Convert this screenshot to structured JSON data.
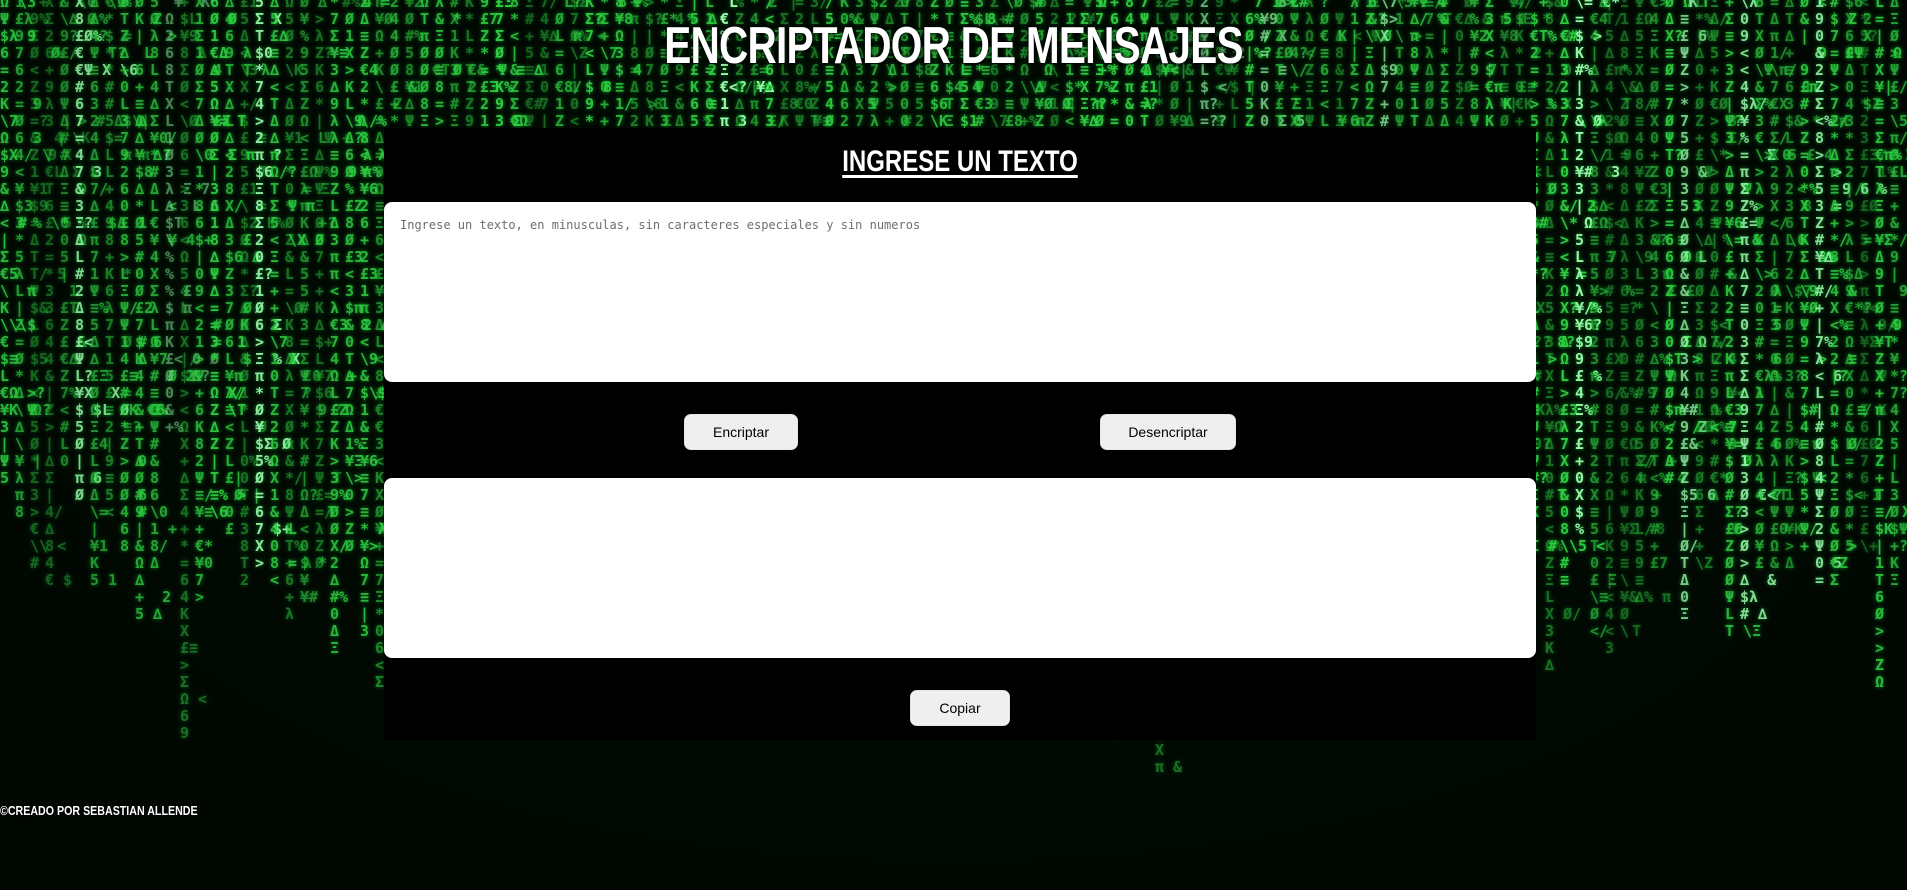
{
  "page": {
    "title": "ENCRIPTADOR DE MENSAJES",
    "background_theme": "matrix-green-code-rain",
    "accent_color": "#2ecc40"
  },
  "panel": {
    "heading": "INGRESE UN TEXTO",
    "input": {
      "placeholder": "Ingrese un texto, en minusculas, sin caracteres especiales y sin numeros",
      "value": ""
    },
    "buttons": {
      "encrypt_label": "Encriptar",
      "decrypt_label": "Desencriptar",
      "copy_label": "Copiar"
    },
    "output": {
      "value": ""
    }
  },
  "footer": {
    "text": "©CREADO POR SEBASTIAN ALLENDE"
  }
}
